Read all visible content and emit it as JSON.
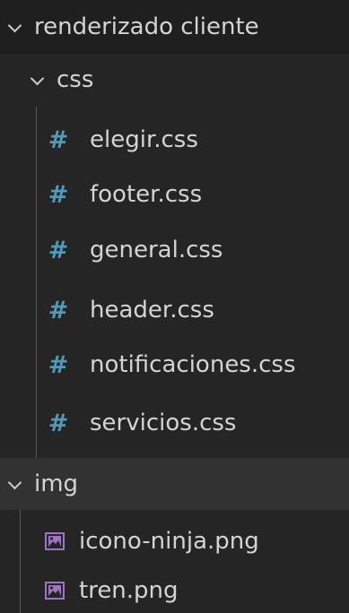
{
  "root_folder": {
    "label": "renderizado cliente",
    "expanded": true
  },
  "css_folder": {
    "label": "css",
    "expanded": true,
    "files": [
      {
        "label": "elegir.css",
        "icon": "css-hash-icon"
      },
      {
        "label": "footer.css",
        "icon": "css-hash-icon"
      },
      {
        "label": "general.css",
        "icon": "css-hash-icon"
      },
      {
        "label": "header.css",
        "icon": "css-hash-icon"
      },
      {
        "label": "notificaciones.css",
        "icon": "css-hash-icon"
      },
      {
        "label": "servicios.css",
        "icon": "css-hash-icon"
      }
    ]
  },
  "img_folder": {
    "label": "img",
    "expanded": true,
    "files": [
      {
        "label": "icono-ninja.png",
        "icon": "image-file-icon"
      },
      {
        "label": "tren.png",
        "icon": "image-file-icon"
      }
    ]
  },
  "colors": {
    "background": "#252526",
    "css_hash": "#519aba",
    "image_icon": "#a074c4",
    "text": "#d4d4d4"
  }
}
